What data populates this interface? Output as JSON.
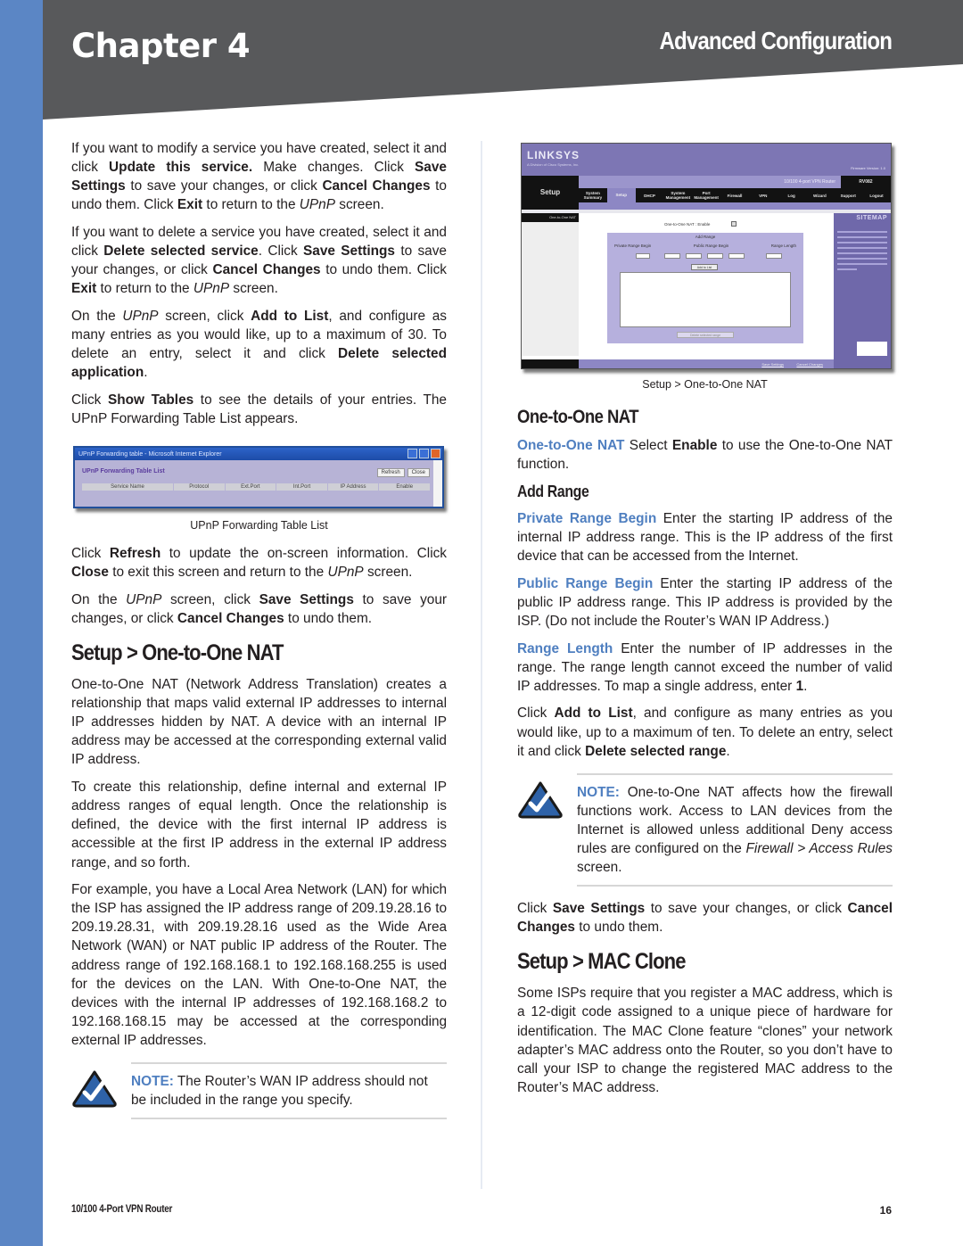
{
  "header": {
    "chapter": "Chapter 4",
    "section": "Advanced Configuration",
    "colors": {
      "band": "#58595b",
      "strip": "#5b86c5",
      "accent": "#4f7fc0"
    }
  },
  "left": {
    "p1": {
      "a": "If you want to modify a service you have created, select it and click ",
      "b1": "Update this service.",
      "c": " Make changes. Click ",
      "b2": "Save Settings",
      "d": " to save your changes, or click ",
      "b3": "Cancel Changes",
      "e": " to undo them. Click ",
      "b4": "Exit",
      "f": " to return to the ",
      "i1": "UPnP",
      "g": " screen."
    },
    "p2": {
      "a": "If you want to delete a service you have created, select it and click ",
      "b1": "Delete selected service",
      "c": ". Click ",
      "b2": "Save Settings",
      "d": " to save your changes, or click ",
      "b3": "Cancel Changes",
      "e": " to undo them. Click ",
      "b4": "Exit",
      "f": " to return to the ",
      "i1": "UPnP",
      "g": " screen."
    },
    "p3": {
      "a": "On the ",
      "i1": "UPnP",
      "b": " screen, click ",
      "b1": "Add to List",
      "c": ", and configure as many entries as you would like, up to a maximum of 30. To delete an entry, select it and click ",
      "b2": "Delete selected application",
      "d": "."
    },
    "p4": {
      "a": "Click ",
      "b1": "Show Tables",
      "b": " to see the details of your entries. The UPnP Forwarding Table List appears."
    },
    "upnp_figure": {
      "window_title": "UPnP Forwarding table - Microsoft Internet Explorer",
      "heading": "UPnP Forwarding Table List",
      "buttons": [
        "Refresh",
        "Close"
      ],
      "columns": [
        "Service Name",
        "Protocol",
        "Ext.Port",
        "Int.Port",
        "IP Address",
        "Enable"
      ],
      "caption": "UPnP Forwarding Table List"
    },
    "p5": {
      "a": "Click ",
      "b1": "Refresh",
      "b": " to update the on-screen information. Click ",
      "b2": "Close",
      "c": " to exit this screen and return to the ",
      "i1": "UPnP",
      "d": " screen."
    },
    "p6": {
      "a": "On the ",
      "i1": "UPnP",
      "b": " screen, click ",
      "b1": "Save Settings",
      "c": " to save your changes, or click ",
      "b2": "Cancel Changes",
      "d": " to undo them."
    },
    "h_nat": "Setup > One-to-One NAT",
    "p7": "One-to-One NAT (Network Address Translation) creates a relationship that maps valid external IP addresses to internal IP addresses hidden by NAT. A device with an internal IP address may be accessed at the corresponding external valid IP address.",
    "p8": "To create this relationship, define internal and external IP address ranges of equal length. Once the relationship is defined, the device with the first internal IP address is accessible at the first IP address in the external IP address range, and so forth.",
    "p9": "For example, you have a Local Area Network (LAN) for which the ISP has assigned the IP address range of 209.19.28.16 to 209.19.28.31, with 209.19.28.16 used as the Wide Area Network (WAN) or NAT public IP address of the Router. The address range of 192.168.168.1 to 192.168.168.255 is used for the devices on the LAN. With One-to-One NAT, the devices with the internal IP addresses of 192.168.168.2 to 192.168.168.15 may be accessed at the corresponding external IP addresses.",
    "note": {
      "label": "NOTE:",
      "text": " The Router’s WAN IP address should not be included in the range you specify."
    }
  },
  "right": {
    "linksys_figure": {
      "logo": "LINKSYS",
      "logo_sub": "A Division of Cisco Systems, Inc.",
      "firmware": "Firmware Version: 1.0",
      "product": "10/100 4-port VPN Router",
      "model": "RV082",
      "setup_label": "Setup",
      "nav": [
        "System Summary",
        "Setup",
        "DHCP",
        "System Management",
        "Port Management",
        "Firewall",
        "VPN",
        "Log",
        "Wizard",
        "Support",
        "Logout"
      ],
      "active_nav": "Setup",
      "left_nav": "One-to-One NAT",
      "content_title": "One-to-One NAT : Enable",
      "panel_title": "Add Range",
      "columns": [
        "Private Range Begin",
        "Public Range Begin",
        "Range Length"
      ],
      "add_button": "Add to List",
      "delete_button": "Delete selected range",
      "save": "Save Settings",
      "cancel": "Cancel Changes",
      "sitemap": "SITEMAP",
      "caption": "Setup > One-to-One NAT"
    },
    "h_nat": "One-to-One NAT",
    "p1": {
      "term": "One-to-One NAT",
      "a": "  Select ",
      "b1": "Enable",
      "b": " to use the One-to-One NAT function."
    },
    "h_add": "Add Range",
    "p2": {
      "term": "Private Range Begin",
      "a": "  Enter the starting IP address of the internal IP address range. This is the IP address of the first device that can be accessed from the Internet."
    },
    "p3": {
      "term": "Public Range Begin",
      "a": "  Enter the starting IP address of the public IP address range. This IP address is provided by the ISP. (Do not include the Router’s WAN IP Address.)"
    },
    "p4": {
      "term": "Range Length",
      "a": "  Enter the number of IP addresses in the range. The range length cannot exceed the number of valid IP addresses. To map a single address, enter ",
      "b1": "1",
      "b": "."
    },
    "p5": {
      "a": "Click ",
      "b1": "Add to List",
      "b": ", and configure as many entries as you would like, up to a maximum of ten. To delete an entry, select it and click ",
      "b2": "Delete selected range",
      "c": "."
    },
    "note": {
      "label": "NOTE:",
      "text": " One-to-One NAT affects how the firewall functions work. Access to LAN devices from the Internet is allowed unless additional Deny access rules are configured on the ",
      "i1": "Firewall > Access Rules",
      "end": " screen."
    },
    "p6": {
      "a": "Click ",
      "b1": "Save Settings",
      "b": " to save your changes, or click ",
      "b2": "Cancel Changes",
      "c": " to undo them."
    },
    "h_mac": "Setup > MAC Clone",
    "p7": "Some ISPs require that you register a MAC address, which is a 12-digit code assigned to a unique piece of hardware for identification. The MAC Clone feature “clones” your network adapter’s MAC address onto the Router, so you don’t have to call your ISP to change the registered MAC address to the Router’s MAC address."
  },
  "footer": {
    "product": "10/100 4-Port VPN Router",
    "page": "16"
  }
}
